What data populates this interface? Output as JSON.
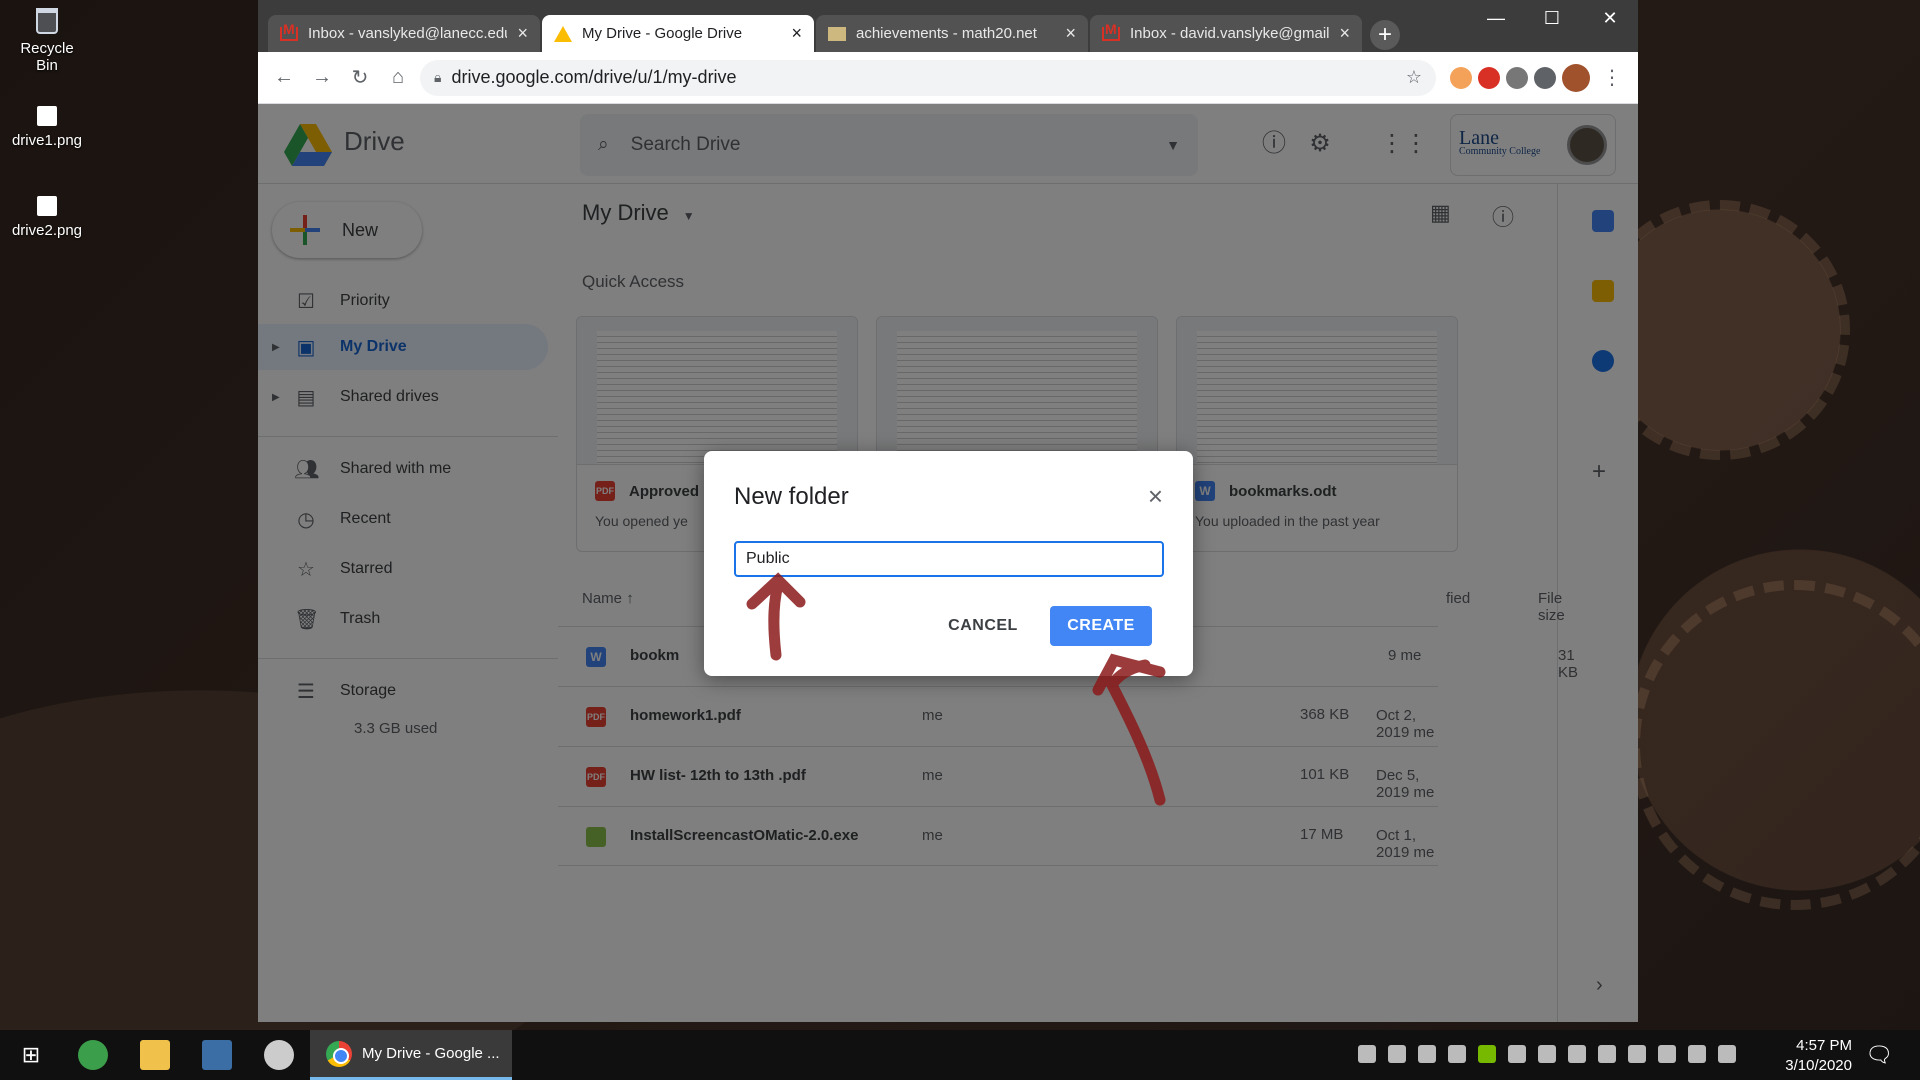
{
  "desktop": {
    "icons": [
      {
        "label": "Recycle Bin"
      },
      {
        "label": "drive1.png"
      },
      {
        "label": "drive2.png"
      }
    ]
  },
  "browser": {
    "tabs": [
      {
        "title": "Inbox - vanslyked@lanecc.edu",
        "favicon": "gmail-icon"
      },
      {
        "title": "My Drive - Google Drive",
        "favicon": "drive-icon",
        "active": true
      },
      {
        "title": "achievements - math20.net",
        "favicon": "site-icon"
      },
      {
        "title": "Inbox - david.vanslyke@gmail.com",
        "favicon": "gmail-icon"
      }
    ],
    "url": "drive.google.com/drive/u/1/my-drive"
  },
  "drive": {
    "product": "Drive",
    "search_placeholder": "Search Drive",
    "account_org": "Lane",
    "account_org_sub": "Community College",
    "new_label": "New",
    "nav": [
      {
        "label": "Priority",
        "icon": "checkbox-icon"
      },
      {
        "label": "My Drive",
        "icon": "my-drive-icon",
        "active": true
      },
      {
        "label": "Shared drives",
        "icon": "shared-drives-icon"
      },
      {
        "label": "Shared with me",
        "icon": "people-icon"
      },
      {
        "label": "Recent",
        "icon": "clock-icon"
      },
      {
        "label": "Starred",
        "icon": "star-icon"
      },
      {
        "label": "Trash",
        "icon": "trash-icon"
      }
    ],
    "storage_label": "Storage",
    "storage_used": "3.3 GB used",
    "breadcrumb": "My Drive",
    "quick_access_label": "Quick Access",
    "quick_access": [
      {
        "name": "Approved",
        "sub": "You opened ye",
        "type": "PDF"
      },
      {
        "name": "",
        "sub": "",
        "type": ""
      },
      {
        "name": "bookmarks.odt",
        "sub": "You uploaded in the past year",
        "type": "W"
      }
    ],
    "columns": {
      "name": "Name",
      "modified": "fied",
      "size": "File size"
    },
    "files": [
      {
        "name": "bookm",
        "owner": "",
        "modified": "9  me",
        "size": "31 KB",
        "type": "W"
      },
      {
        "name": "homework1.pdf",
        "owner": "me",
        "modified": "Oct 2, 2019  me",
        "size": "368 KB",
        "type": "PDF"
      },
      {
        "name": "HW list- 12th to 13th .pdf",
        "owner": "me",
        "modified": "Dec 5, 2019  me",
        "size": "101 KB",
        "type": "PDF"
      },
      {
        "name": "InstallScreencastOMatic-2.0.exe",
        "owner": "me",
        "modified": "Oct 1, 2019  me",
        "size": "17 MB",
        "type": "exe"
      }
    ]
  },
  "dialog": {
    "title": "New folder",
    "input_value": "Public",
    "cancel_label": "CANCEL",
    "create_label": "CREATE"
  },
  "taskbar": {
    "app_label": "My Drive - Google ...",
    "time": "4:57 PM",
    "date": "3/10/2020"
  },
  "colors": {
    "accent": "#4285f4",
    "active_nav_bg": "#e8f0fe",
    "annotation": "#8b1a1a"
  }
}
